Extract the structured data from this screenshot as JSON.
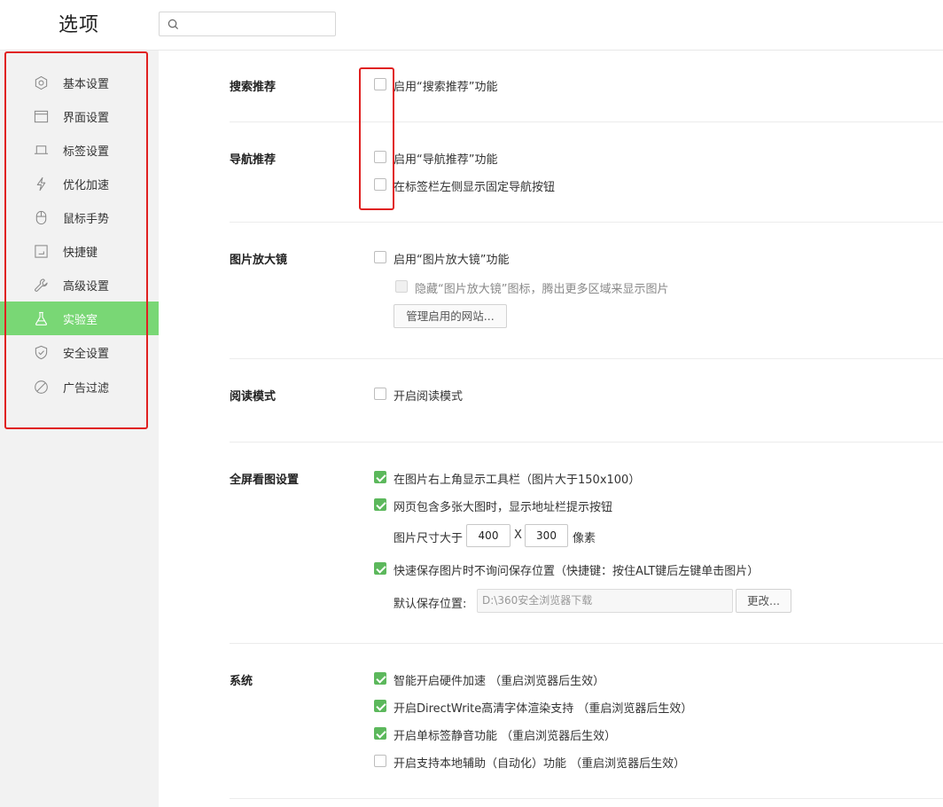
{
  "header": {
    "title": "选项",
    "search": {
      "placeholder": "",
      "value": ""
    }
  },
  "sidebar": {
    "items": [
      {
        "label": "基本设置",
        "icon": "gear-icon"
      },
      {
        "label": "界面设置",
        "icon": "window-icon"
      },
      {
        "label": "标签设置",
        "icon": "tab-icon"
      },
      {
        "label": "优化加速",
        "icon": "lightning-icon"
      },
      {
        "label": "鼠标手势",
        "icon": "mouse-icon"
      },
      {
        "label": "快捷键",
        "icon": "keyboard-icon"
      },
      {
        "label": "高级设置",
        "icon": "wrench-icon"
      },
      {
        "label": "实验室",
        "icon": "flask-icon",
        "active": true
      },
      {
        "label": "安全设置",
        "icon": "shield-icon"
      },
      {
        "label": "广告过滤",
        "icon": "block-icon"
      }
    ]
  },
  "sections": {
    "search_rec": {
      "title": "搜索推荐",
      "opt1": "启用“搜索推荐”功能"
    },
    "nav_rec": {
      "title": "导航推荐",
      "opt1": "启用“导航推荐”功能",
      "opt2": "在标签栏左侧显示固定导航按钮"
    },
    "magnifier": {
      "title": "图片放大镜",
      "opt1": "启用“图片放大镜”功能",
      "opt2": "隐藏“图片放大镜”图标，腾出更多区域来显示图片",
      "manage_button": "管理启用的网站..."
    },
    "reading": {
      "title": "阅读模式",
      "opt1": "开启阅读模式"
    },
    "fullscreen": {
      "title": "全屏看图设置",
      "opt1": "在图片右上角显示工具栏（图片大于150x100）",
      "opt2": "网页包含多张大图时，显示地址栏提示按钮",
      "size_label": "图片尺寸大于",
      "width": "400",
      "x_label": "X",
      "height": "300",
      "unit": "像素",
      "opt3": "快速保存图片时不询问保存位置（快捷键：按住ALT键后左键单击图片）",
      "save_label": "默认保存位置:",
      "save_path": "D:\\360安全浏览器下载",
      "change_button": "更改..."
    },
    "system": {
      "title": "系统",
      "opt1": "智能开启硬件加速 （重启浏览器后生效）",
      "opt2": "开启DirectWrite高清字体渲染支持 （重启浏览器后生效）",
      "opt3": "开启单标签静音功能 （重启浏览器后生效）",
      "opt4": "开启支持本地辅助（自动化）功能 （重启浏览器后生效）"
    }
  },
  "colors": {
    "accent": "#79d775",
    "check": "#5cb85c",
    "highlight": "#e02020"
  }
}
